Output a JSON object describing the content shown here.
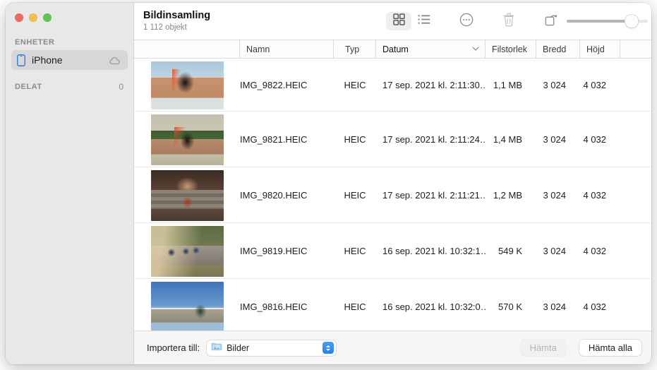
{
  "window": {
    "title": "Bildinsamling",
    "subtitle": "1 112 objekt",
    "traffic_lights": [
      "close-button",
      "minimize-button",
      "zoom-button"
    ]
  },
  "sidebar": {
    "sections": [
      {
        "header": "ENHETER",
        "badge": null
      },
      {
        "header": "DELAT",
        "badge": "0"
      }
    ],
    "devices": [
      {
        "label": "iPhone",
        "icon": "iphone-icon",
        "accessory": "cloud-icon",
        "selected": true
      }
    ]
  },
  "toolbar": {
    "buttons": [
      {
        "name": "grid-view-button",
        "icon": "grid-icon",
        "active": true
      },
      {
        "name": "list-view-button",
        "icon": "list-icon",
        "active": false
      },
      {
        "name": "more-options-button",
        "icon": "ellipsis-circle-icon",
        "active": false
      },
      {
        "name": "delete-button",
        "icon": "trash-icon",
        "active": false
      },
      {
        "name": "rotate-button",
        "icon": "rotate-icon",
        "active": false
      }
    ],
    "zoom_slider": {
      "name": "thumbnail-size-slider",
      "value": 80,
      "min": 0,
      "max": 100
    }
  },
  "table": {
    "columns": [
      {
        "key": "thumbnail",
        "label": ""
      },
      {
        "key": "namn",
        "label": "Namn"
      },
      {
        "key": "typ",
        "label": "Typ"
      },
      {
        "key": "datum",
        "label": "Datum",
        "sorted": true,
        "sort_direction": "descending"
      },
      {
        "key": "filstorlek",
        "label": "Filstorlek"
      },
      {
        "key": "bredd",
        "label": "Bredd"
      },
      {
        "key": "hojd",
        "label": "Höjd"
      }
    ],
    "rows": [
      {
        "thumbnail": "th-sari-wall",
        "namn": "IMG_9822.HEIC",
        "typ": "HEIC",
        "datum": "17 sep. 2021 kl. 2:11:30…",
        "filstorlek": "1,1 MB",
        "bredd": "3 024",
        "hojd": "4 032"
      },
      {
        "thumbnail": "th-sari-garden",
        "namn": "IMG_9821.HEIC",
        "typ": "HEIC",
        "datum": "17 sep. 2021 kl. 2:11:24…",
        "filstorlek": "1,4 MB",
        "bredd": "3 024",
        "hojd": "4 032"
      },
      {
        "thumbnail": "th-steps",
        "namn": "IMG_9820.HEIC",
        "typ": "HEIC",
        "datum": "17 sep. 2021 kl. 2:11:21…",
        "filstorlek": "1,2 MB",
        "bredd": "3 024",
        "hojd": "4 032"
      },
      {
        "thumbnail": "th-cyclists",
        "namn": "IMG_9819.HEIC",
        "typ": "HEIC",
        "datum": "16 sep. 2021 kl. 10:32:1…",
        "filstorlek": "549 K",
        "bredd": "3 024",
        "hojd": "4 032"
      },
      {
        "thumbnail": "th-coast",
        "namn": "IMG_9816.HEIC",
        "typ": "HEIC",
        "datum": "16 sep. 2021 kl. 10:32:0…",
        "filstorlek": "570 K",
        "bredd": "3 024",
        "hojd": "4 032"
      }
    ]
  },
  "bottom_bar": {
    "import_label": "Importera till:",
    "destination": {
      "value": "Bilder",
      "icon": "pictures-folder-icon"
    },
    "download_button": {
      "label": "Hämta",
      "enabled": false
    },
    "download_all_button": {
      "label": "Hämta alla",
      "enabled": true
    }
  },
  "colors": {
    "accent": "#2b7def",
    "sidebar_bg": "#e8e8e8",
    "selected_row": "#d7d7d7",
    "traffic_red": "#ec6a5e",
    "traffic_yellow": "#f3bf4f",
    "traffic_green": "#61c555"
  }
}
